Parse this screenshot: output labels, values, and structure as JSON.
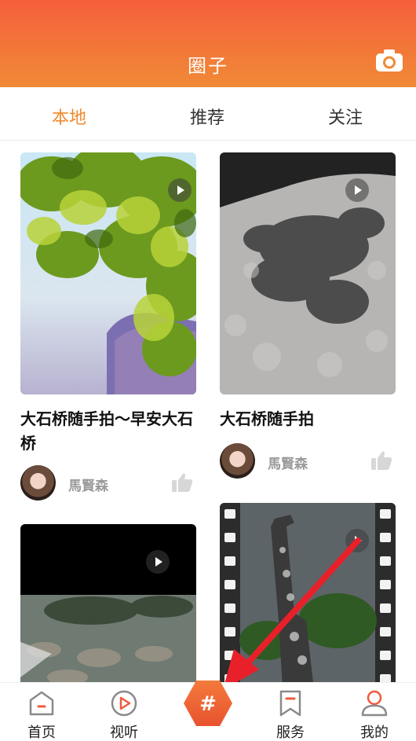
{
  "header": {
    "title": "圈子",
    "camera_icon": "camera-icon"
  },
  "tabs": [
    {
      "label": "本地",
      "active": true
    },
    {
      "label": "推荐",
      "active": false
    },
    {
      "label": "关注",
      "active": false
    }
  ],
  "posts": [
    {
      "title": "大石桥随手拍～早安大石桥",
      "author": "馬賢森"
    },
    {
      "title": "大石桥随手拍",
      "author": "馬賢森"
    }
  ],
  "bottom_nav": {
    "items": [
      {
        "label": "首页",
        "icon": "home-icon"
      },
      {
        "label": "视听",
        "icon": "play-circle-icon"
      },
      {
        "label": "#",
        "icon": "hashtag-icon"
      },
      {
        "label": "服务",
        "icon": "bookmark-icon"
      },
      {
        "label": "我的",
        "icon": "user-icon"
      }
    ]
  },
  "colors": {
    "accent": "#ef8a2e",
    "header_top": "#f65f3c",
    "header_bottom": "#f08a36",
    "arrow": "#e8202a"
  }
}
